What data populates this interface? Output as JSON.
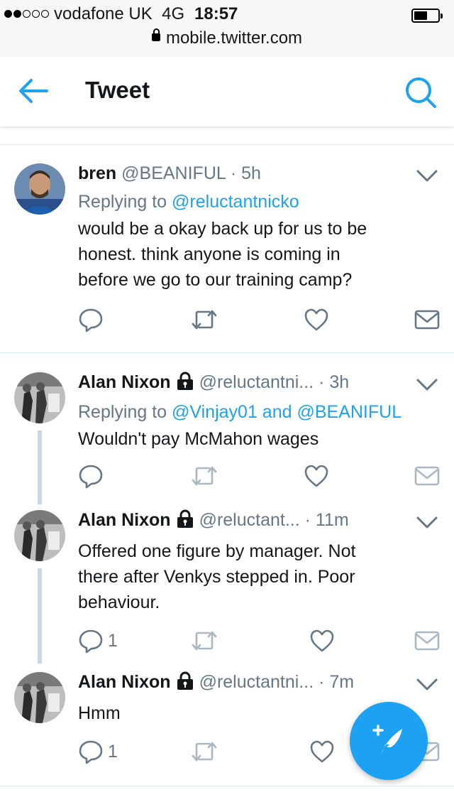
{
  "status_bar": {
    "carrier": "vodafone UK",
    "network": "4G",
    "time": "18:57",
    "url": "mobile.twitter.com",
    "signal_bars_filled": 2,
    "signal_bars_total": 5
  },
  "nav": {
    "title": "Tweet",
    "back_icon": "arrow-left-icon",
    "search_icon": "search-icon"
  },
  "colors": {
    "accent": "#1da1f2",
    "muted": "#657786",
    "text": "#14171a",
    "thread_line": "#ccd6dd"
  },
  "tweets": [
    {
      "name": "bren",
      "handle": "@BEANIFUL",
      "separator": "·",
      "age": "5h",
      "protected": false,
      "reply_prefix": "Replying to",
      "reply_to": "@reluctantnicko",
      "text_lines": [
        "would be a okay back up for us to be",
        "honest. think anyone is coming in",
        "before we go to our training camp?"
      ],
      "reply_count": "",
      "avatar_icon": "profile-photo"
    },
    {
      "name": "Alan Nixon",
      "handle": "@reluctantni...",
      "separator": "·",
      "age": "3h",
      "protected": true,
      "reply_prefix": "Replying to",
      "reply_to": "@Vinjay01 and @BEANIFUL",
      "text_lines": [
        "Wouldn't pay McMahon wages"
      ],
      "reply_count": "",
      "avatar_icon": "profile-photo"
    },
    {
      "name": "Alan Nixon",
      "handle": "@reluctant...",
      "separator": "·",
      "age": "11m",
      "protected": true,
      "text_lines": [
        "Offered one figure by manager. Not",
        "there after Venkys stepped in. Poor",
        "behaviour."
      ],
      "reply_count": "1",
      "avatar_icon": "profile-photo"
    },
    {
      "name": "Alan Nixon",
      "handle": "@reluctantni...",
      "separator": "·",
      "age": "7m",
      "protected": true,
      "text_lines": [
        "Hmm"
      ],
      "reply_count": "1",
      "avatar_icon": "profile-photo"
    }
  ],
  "icons": {
    "reply": "reply-icon",
    "retweet": "retweet-icon",
    "like": "heart-icon",
    "dm": "envelope-icon",
    "more": "chevron-down-icon",
    "lock": "lock-icon",
    "compose": "compose-tweet-icon"
  }
}
